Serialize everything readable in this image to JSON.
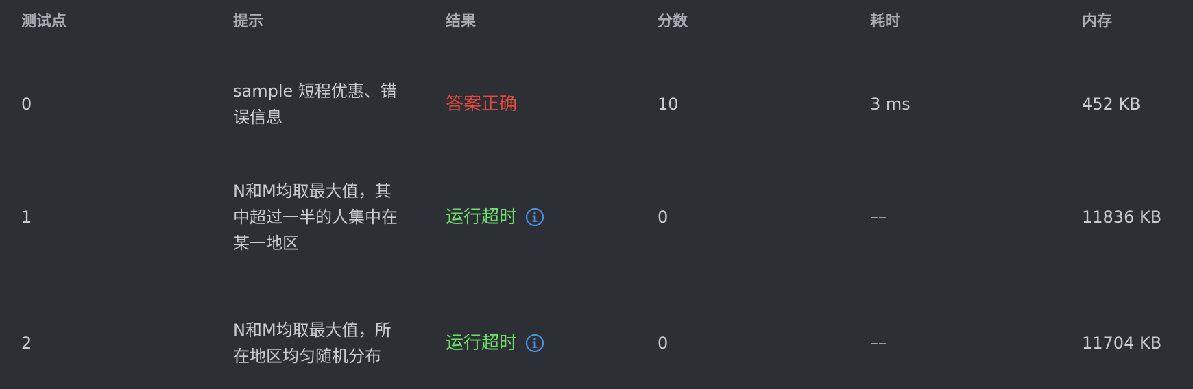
{
  "headers": {
    "case": "测试点",
    "hint": "提示",
    "result": "结果",
    "score": "分数",
    "time": "耗时",
    "memory": "内存"
  },
  "rows": [
    {
      "case": "0",
      "hint": "sample 短程优惠、错误信息",
      "result": "答案正确",
      "result_icon": "",
      "score": "10",
      "time": "3 ms",
      "memory": "452 KB"
    },
    {
      "case": "1",
      "hint": "N和M均取最大值，其中超过一半的人集中在某一地区",
      "result": "运行超时",
      "result_icon": "info-icon",
      "score": "0",
      "time": "––",
      "memory": "11836 KB"
    },
    {
      "case": "2",
      "hint": "N和M均取最大值，所在地区均匀随机分布",
      "result": "运行超时",
      "result_icon": "info-icon",
      "score": "0",
      "time": "––",
      "memory": "11704 KB"
    }
  ],
  "colors": {
    "background": "#2c2f34",
    "text": "#c9ccd1",
    "header_text": "#a9adb3",
    "accepted": "#e2493f",
    "time_limit_exceeded": "#6fe06a",
    "info_icon": "#4d8fe0"
  }
}
